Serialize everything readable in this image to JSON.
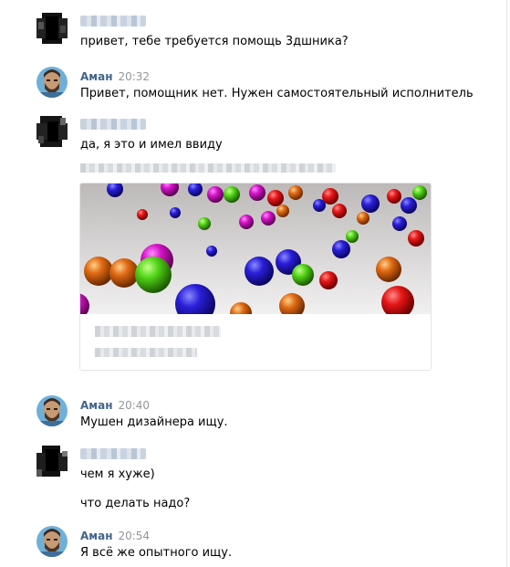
{
  "messages": [
    {
      "text": "привет, тебе требуется помощь 3дшника?"
    },
    {
      "name": "Аман",
      "time": "20:32",
      "text": "Привет, помощник нет. Нужен самостоятельный исполнитель"
    },
    {
      "text": "да, я это и имел ввиду"
    },
    {
      "name": "Аман",
      "time": "20:40",
      "text": "Мушен дизайнера ищу."
    },
    {
      "text": "чем я хуже)"
    },
    {
      "text": "что делать надо?"
    },
    {
      "name": "Аман",
      "time": "20:54",
      "text": "Я всё же опытного ищу."
    }
  ],
  "colors": {
    "name": "#42648b",
    "time": "#939699"
  },
  "icons": {
    "pixelated_avatar": "pixelated-avatar-icon",
    "aman_avatar": "bearded-man-avatar"
  }
}
